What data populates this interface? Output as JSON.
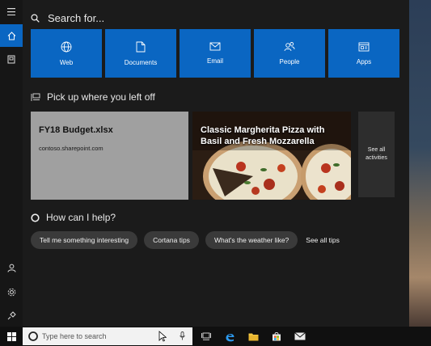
{
  "search": {
    "label": "Search for..."
  },
  "tiles": [
    {
      "label": "Web",
      "icon": "globe-icon"
    },
    {
      "label": "Documents",
      "icon": "document-icon"
    },
    {
      "label": "Email",
      "icon": "envelope-icon"
    },
    {
      "label": "People",
      "icon": "people-icon"
    },
    {
      "label": "Apps",
      "icon": "apps-icon"
    }
  ],
  "activities": {
    "title": "Pick up where you left off",
    "doc": {
      "title": "FY18 Budget.xlsx",
      "subtitle": "contoso.sharepoint.com"
    },
    "pizza": {
      "title": "Classic Margherita Pizza with Basil and Fresh Mozzarella"
    },
    "see_all": "See all activities"
  },
  "help": {
    "title": "How can I help?",
    "chips": [
      "Tell me something interesting",
      "Cortana tips",
      "What's the weather like?"
    ],
    "see_all": "See all tips"
  },
  "taskbar": {
    "search_placeholder": "Type here to search"
  },
  "colors": {
    "accent": "#0a66c2",
    "panel": "#1b1b1b",
    "rail": "#161616",
    "taskbar": "#101010"
  }
}
